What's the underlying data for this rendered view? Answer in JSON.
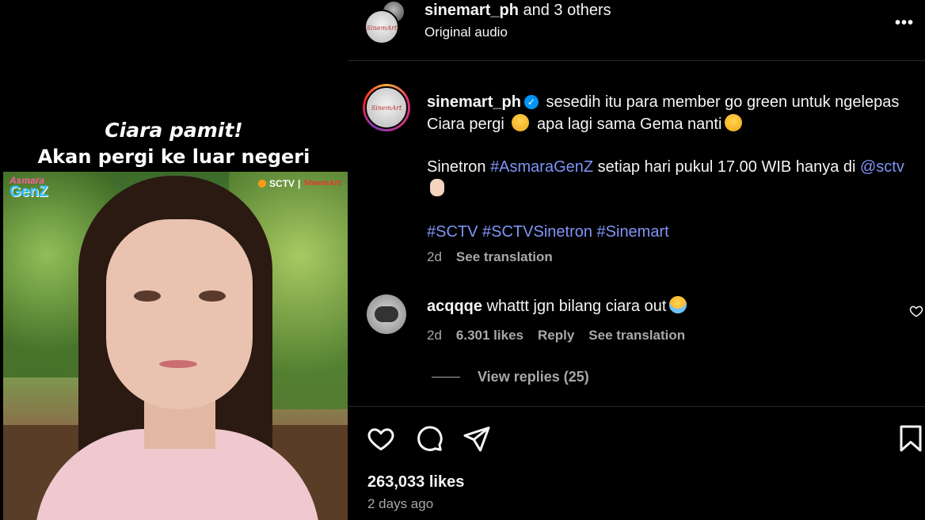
{
  "media": {
    "caption_line1": "Ciara pamit!",
    "caption_line2": "Akan pergi ke luar negeri",
    "logo_show": "Asmara",
    "logo_show2": "GenZ",
    "logo_channel": "SCTV",
    "logo_studio": "SinemArt"
  },
  "header": {
    "username": "sinemart_ph",
    "others": " and 3 others",
    "subtitle": "Original audio",
    "more": "•••",
    "avatar_mark": "SinemArt"
  },
  "post": {
    "username": "sinemart_ph",
    "verified": "✓",
    "text1": "sesedih itu para member go green untuk ngelepas Ciara pergi",
    "text2": "apa lagi sama Gema nanti",
    "line2_prefix": "Sinetron ",
    "line2_tag": "#AsmaraGenZ",
    "line2_mid": " setiap hari pukul 17.00 WIB hanya di ",
    "line2_mention": "@sctv",
    "tags": "#SCTV #SCTVSinetron #Sinemart",
    "age": "2d",
    "see_translation": "See translation"
  },
  "comment": {
    "username": "acqqqe",
    "text": "whattt jgn bilang ciara out",
    "age": "2d",
    "likes": "6.301 likes",
    "reply": "Reply",
    "see_translation": "See translation",
    "view_replies": "View replies (25)"
  },
  "footer": {
    "likes": "263,033 likes",
    "ago": "2 days ago"
  },
  "icons": {
    "like": "heart-icon",
    "comment": "comment-icon",
    "share": "paper-plane-icon",
    "save": "bookmark-icon"
  },
  "colors": {
    "background": "#000000",
    "link": "#7f94f5",
    "muted": "#a8a8a8",
    "verified": "#0095f6"
  }
}
